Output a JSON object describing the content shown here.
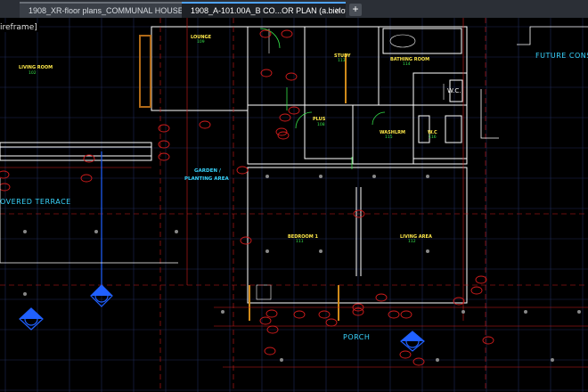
{
  "tabs": [
    {
      "label": "1908_XR-floor plans_COMMUNAL HOUSE*",
      "active": false
    },
    {
      "label": "1908_A-101.00A_B CO...OR PLAN (a.bielov)*",
      "active": true
    }
  ],
  "new_tab_label": "+",
  "close_glyph": "×",
  "viewport_label": "ireframe]",
  "labels": {
    "future": "FUTURE CONST",
    "covered_terrace": "OVERED TERRACE",
    "porch": "PORCH",
    "garden_line1": "GARDEN /",
    "garden_line2": "PLANTING AREA",
    "wc_big": "W.C.",
    "lounge": "LOUNGE",
    "lounge_num": "109",
    "living_room_left": "LIVING ROOM",
    "living_room_left_num": "102",
    "study": "STUDY",
    "study_num": "113",
    "bathing_room": "BATHING ROOM",
    "bathing_room_num": "114",
    "plus": "PLUS",
    "plus_num": "108",
    "washlrm": "WASHLRM",
    "washlrm_num": "115",
    "wc_small": "W.C",
    "wc_small_num": "116",
    "bedroom": "BEDROOM 1",
    "bedroom_num": "111",
    "living_area": "LIVING AREA",
    "living_area_num": "112"
  },
  "colors": {
    "background": "#000000",
    "wall": "#ffffff",
    "grid": "#1e2a55",
    "dims": "#d01c1c",
    "annotation": "#39d6ff",
    "tags": "#ffe94a",
    "green": "#35e04a",
    "section_marker": "#2060ff",
    "tab_accent": "#4fa3ff"
  }
}
